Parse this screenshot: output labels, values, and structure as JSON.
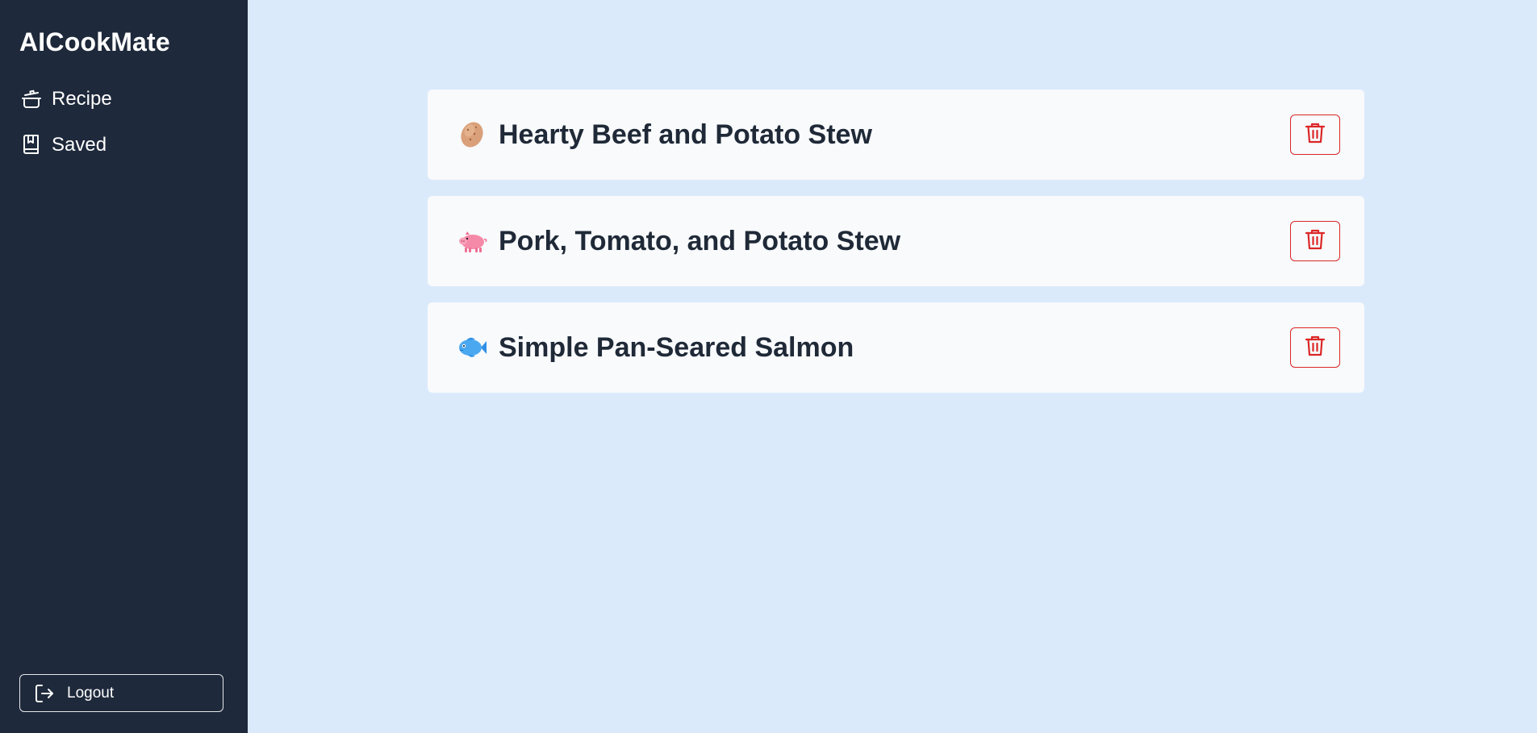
{
  "app": {
    "brand": "AICookMate"
  },
  "sidebar": {
    "items": [
      {
        "label": "Recipe",
        "icon": "cooking-pot-icon"
      },
      {
        "label": "Saved",
        "icon": "bookmark-book-icon"
      }
    ],
    "logout_label": "Logout"
  },
  "recipes": [
    {
      "title": "Hearty Beef and Potato Stew",
      "icon": "potato-icon"
    },
    {
      "title": "Pork, Tomato, and Potato Stew",
      "icon": "pig-icon"
    },
    {
      "title": "Simple Pan-Seared Salmon",
      "icon": "fish-icon"
    }
  ],
  "colors": {
    "sidebar_bg": "#1e293b",
    "page_bg": "#dbeafb",
    "card_bg": "#f8fafc",
    "delete_accent": "#dc2626"
  }
}
